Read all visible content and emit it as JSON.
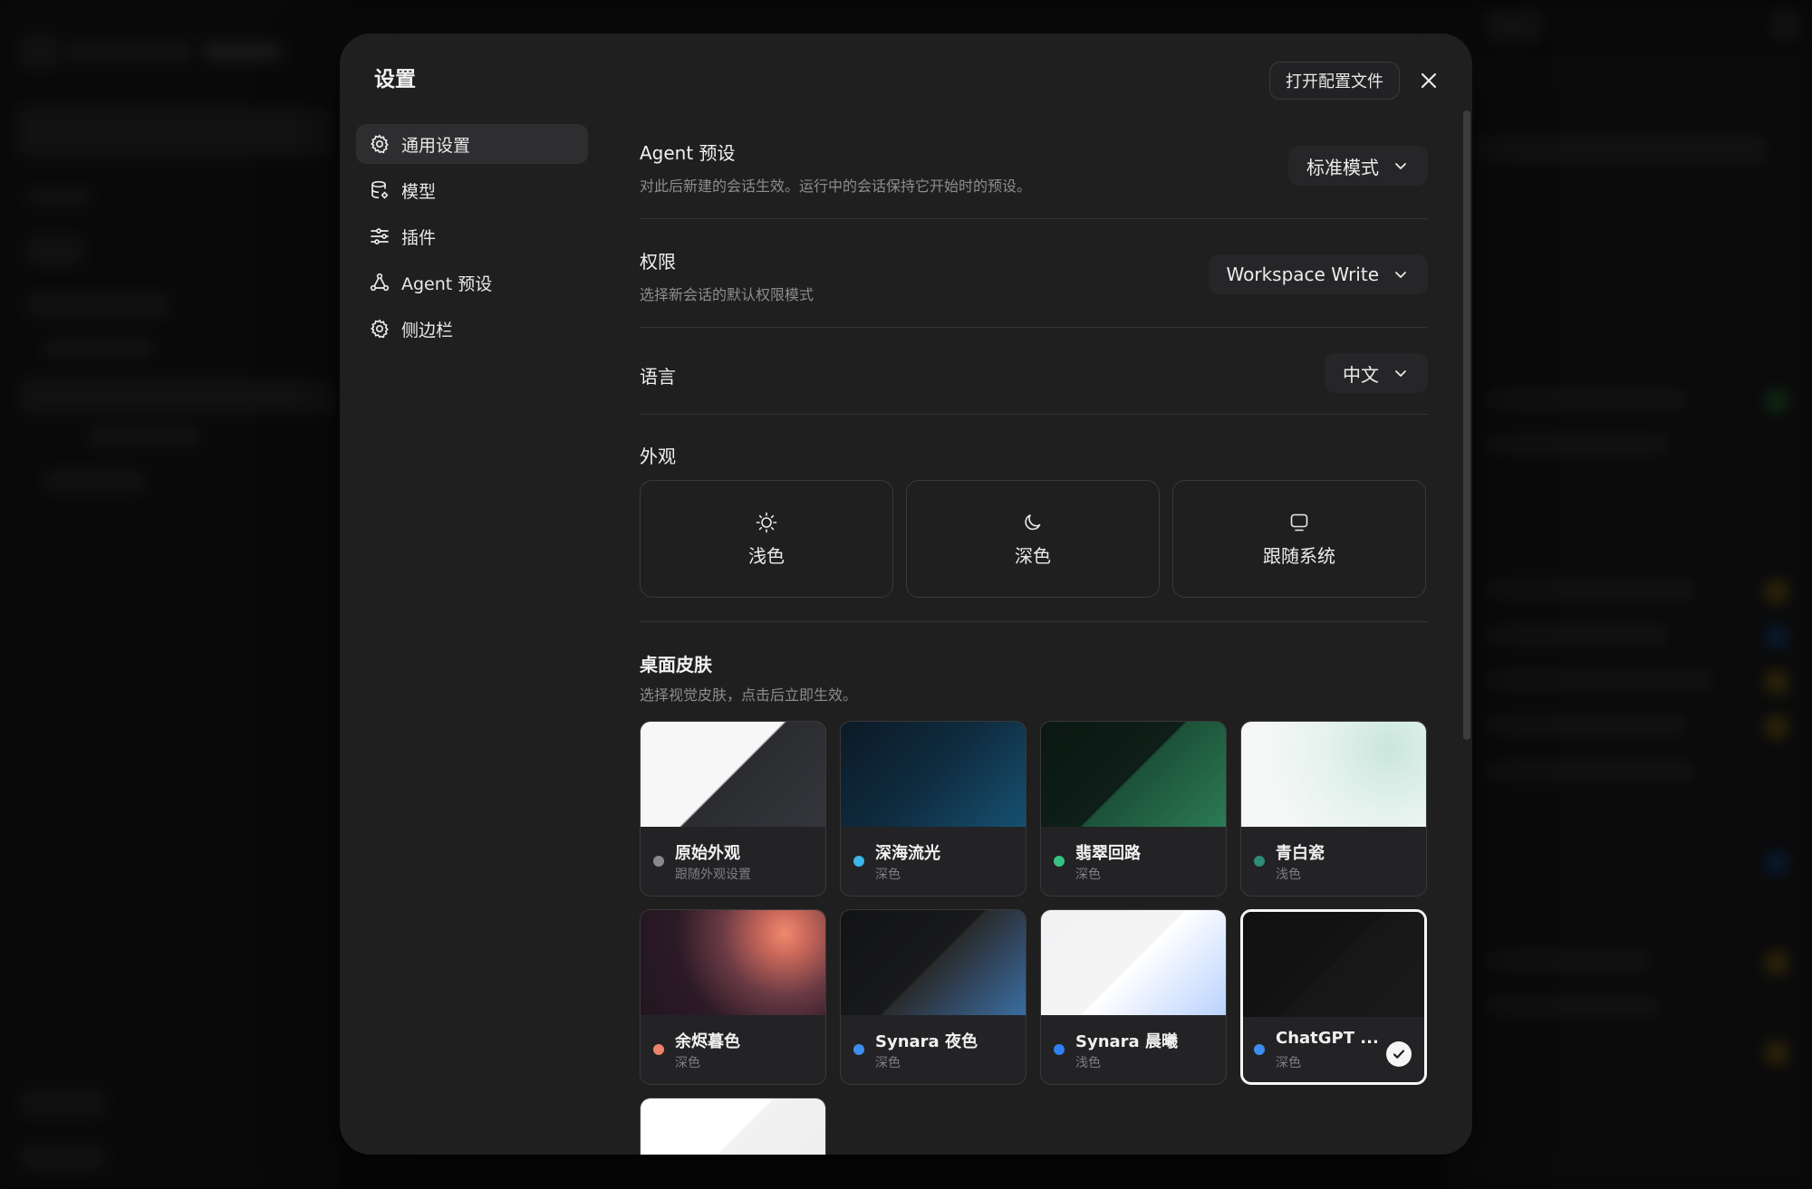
{
  "modal": {
    "title": "设置",
    "open_config_label": "打开配置文件"
  },
  "nav": {
    "items": [
      {
        "label": "通用设置",
        "icon": "gear-icon",
        "active": true
      },
      {
        "label": "模型",
        "icon": "database-icon"
      },
      {
        "label": "插件",
        "icon": "sliders-icon"
      },
      {
        "label": "Agent 预设",
        "icon": "agent-icon"
      },
      {
        "label": "侧边栏",
        "icon": "gear-icon"
      }
    ]
  },
  "settings": {
    "agent_preset": {
      "title": "Agent 预设",
      "description": "对此后新建的会话生效。运行中的会话保持它开始时的预设。",
      "value": "标准模式"
    },
    "permission": {
      "title": "权限",
      "description": "选择新会话的默认权限模式",
      "value": "Workspace Write"
    },
    "language": {
      "title": "语言",
      "value": "中文"
    },
    "appearance": {
      "title": "外观",
      "options": [
        {
          "label": "浅色",
          "icon": "sun-icon"
        },
        {
          "label": "深色",
          "icon": "moon-icon"
        },
        {
          "label": "跟随系统",
          "icon": "monitor-icon"
        }
      ]
    },
    "skins": {
      "title": "桌面皮肤",
      "description": "选择视觉皮肤，点击后立即生效。",
      "items": [
        {
          "name": "原始外观",
          "sub": "跟随外观设置",
          "dot": "#8a8a8e"
        },
        {
          "name": "深海流光",
          "sub": "深色",
          "dot": "#3fb6ea"
        },
        {
          "name": "翡翠回路",
          "sub": "深色",
          "dot": "#37c285"
        },
        {
          "name": "青白瓷",
          "sub": "浅色",
          "dot": "#2f8a78"
        },
        {
          "name": "余烬暮色",
          "sub": "深色",
          "dot": "#f0836b"
        },
        {
          "name": "Synara 夜色",
          "sub": "深色",
          "dot": "#3d8ef0"
        },
        {
          "name": "Synara 晨曦",
          "sub": "浅色",
          "dot": "#2f7ff5"
        },
        {
          "name": "ChatGPT ...",
          "sub": "深色",
          "dot": "#3d8ef0",
          "selected": true
        },
        {
          "name": "",
          "sub": "",
          "dot": "#ffffff"
        }
      ]
    }
  }
}
